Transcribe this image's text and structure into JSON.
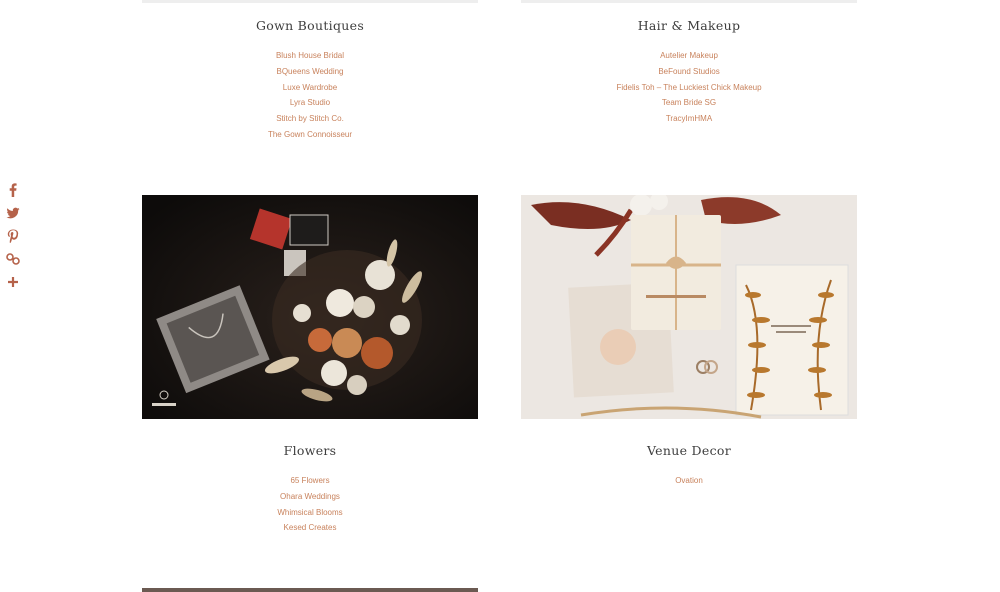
{
  "sections": {
    "gown": {
      "title": "Gown Boutiques",
      "items": [
        "Blush House Bridal",
        "BQueens Wedding",
        "Luxe Wardrobe",
        "Lyra Studio",
        "Stitch by Stitch Co.",
        "The Gown Connoisseur"
      ]
    },
    "hair": {
      "title": "Hair & Makeup",
      "items": [
        "Autelier Makeup",
        "BeFound Studios",
        "Fidelis Toh – The Luckiest Chick Makeup",
        "Team Bride SG",
        "TracyImHMA"
      ]
    },
    "flowers": {
      "title": "Flowers",
      "items": [
        "65 Flowers",
        "Ohara Weddings",
        "Whimsical Blooms",
        "Kesed Creates"
      ]
    },
    "venue": {
      "title": "Venue Decor",
      "items": [
        "Ovation"
      ]
    }
  },
  "share": {
    "icons": [
      "facebook-icon",
      "twitter-icon",
      "pinterest-icon",
      "copy-link-icon",
      "more-icon"
    ]
  },
  "colors": {
    "link": "#c8825c",
    "heading": "#3d3d3d",
    "share_icon": "#b5624a"
  }
}
